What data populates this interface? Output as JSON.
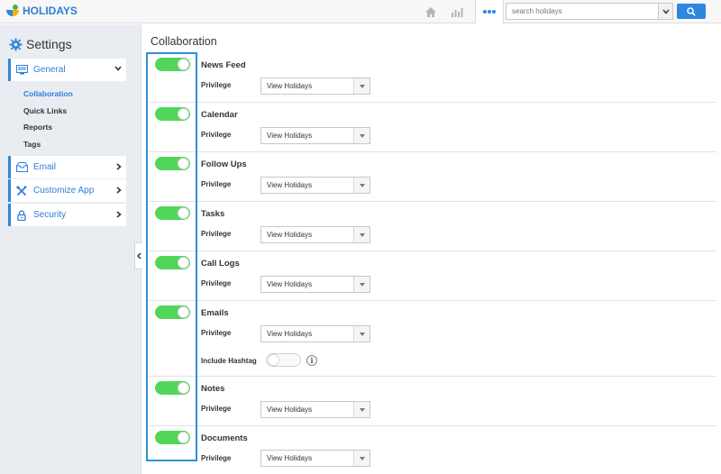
{
  "header": {
    "brand": "HOLIDAYS",
    "search_placeholder": "search holidays",
    "nav": [
      "home-icon",
      "chart-icon",
      "more-icon"
    ],
    "accent_color": "#2e86de"
  },
  "sidebar": {
    "title": "Settings",
    "items": [
      {
        "label": "General",
        "icon": "monitor-icon",
        "expanded": true
      },
      {
        "label": "Email",
        "icon": "inbox-icon"
      },
      {
        "label": "Customize App",
        "icon": "tools-icon"
      },
      {
        "label": "Security",
        "icon": "lock-icon"
      }
    ],
    "sub_items": [
      {
        "label": "Collaboration",
        "active": true
      },
      {
        "label": "Quick Links"
      },
      {
        "label": "Reports"
      },
      {
        "label": "Tags"
      }
    ]
  },
  "main": {
    "title": "Collaboration",
    "privilege_label": "Privilege",
    "rows": [
      {
        "title": "News Feed",
        "enabled": true,
        "privilege": "View Holidays"
      },
      {
        "title": "Calendar",
        "enabled": true,
        "privilege": "View Holidays"
      },
      {
        "title": "Follow Ups",
        "enabled": true,
        "privilege": "View Holidays"
      },
      {
        "title": "Tasks",
        "enabled": true,
        "privilege": "View Holidays"
      },
      {
        "title": "Call Logs",
        "enabled": true,
        "privilege": "View Holidays"
      },
      {
        "title": "Emails",
        "enabled": true,
        "privilege": "View Holidays",
        "extra_label": "Include Hashtag",
        "extra_enabled": false,
        "extra_info": "i"
      },
      {
        "title": "Notes",
        "enabled": true,
        "privilege": "View Holidays"
      },
      {
        "title": "Documents",
        "enabled": true,
        "privilege": "View Holidays"
      }
    ]
  }
}
